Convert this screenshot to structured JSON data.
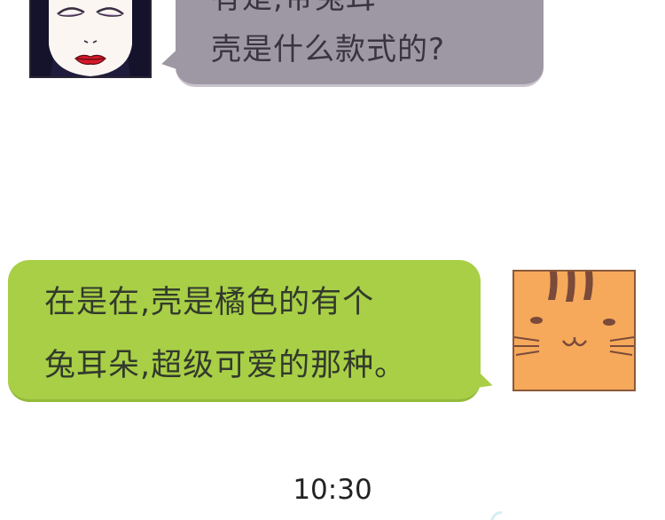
{
  "chat": {
    "incoming": {
      "avatar_icon": "woman-avatar-icon",
      "bubble_color": "#9e98a4",
      "line_cut": "有是,带兔耳",
      "line_full": "壳是什么款式的?"
    },
    "outgoing": {
      "avatar_icon": "cat-avatar-icon",
      "bubble_color": "#a8cf46",
      "lines": [
        "在是在,壳是橘色的有个",
        "兔耳朵,超级可爱的那种。"
      ]
    },
    "timestamp": "10:30"
  },
  "colors": {
    "background": "#ffffff",
    "cat_orange": "#f6a95a",
    "woman_bg": "#1f1b3c"
  }
}
